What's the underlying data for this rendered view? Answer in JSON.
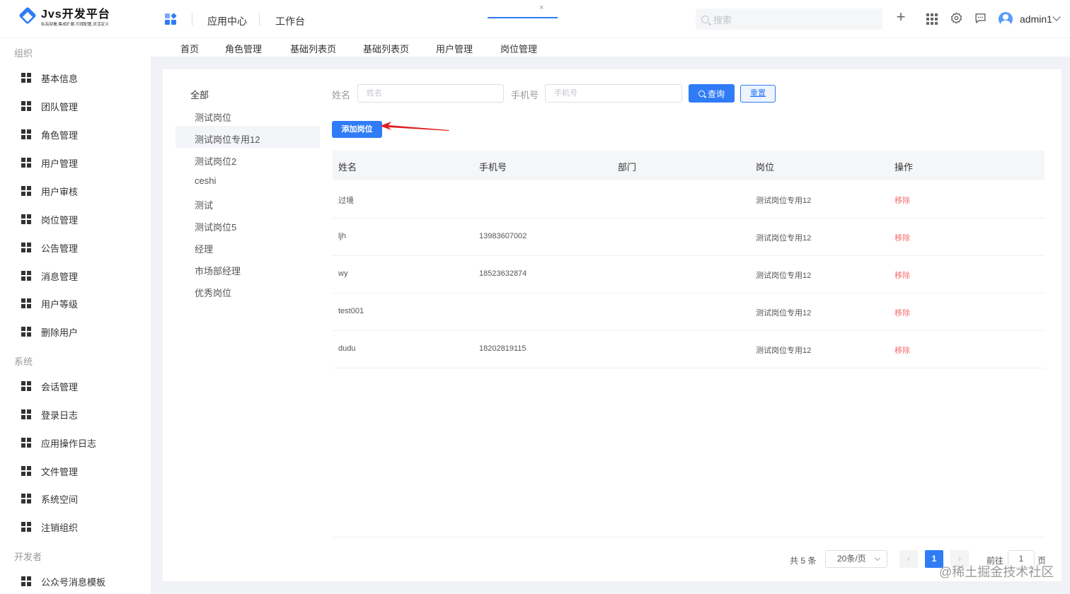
{
  "header": {
    "logo_title": "Jvs开发平台",
    "logo_subtitle": "私有部署,集成扩展,可视配置,灵活定义",
    "nav": [
      "应用中心",
      "工作台"
    ],
    "search_placeholder": "搜索",
    "user": "admin1",
    "icons": [
      "plus-icon",
      "apps-grid-icon",
      "settings-icon",
      "message-icon"
    ]
  },
  "sidebar": {
    "groups": [
      {
        "label": "组织",
        "items": [
          "基本信息",
          "团队管理",
          "角色管理",
          "用户管理",
          "用户审核",
          "岗位管理",
          "公告管理",
          "消息管理",
          "用户等级",
          "删除用户"
        ]
      },
      {
        "label": "系统",
        "items": [
          "会话管理",
          "登录日志",
          "应用操作日志",
          "文件管理",
          "系统空间",
          "注销组织"
        ]
      },
      {
        "label": "开发者",
        "items": [
          "公众号消息模板"
        ]
      }
    ]
  },
  "tabs": {
    "items": [
      "首页",
      "角色管理",
      "基础列表页",
      "基础列表页",
      "用户管理",
      "岗位管理"
    ],
    "active": "岗位管理",
    "close": "×"
  },
  "categories": {
    "all": "全部",
    "items": [
      "测试岗位",
      "测试岗位专用12",
      "测试岗位2",
      "ceshi",
      "测试",
      "测试岗位5",
      "经理",
      "市场部经理",
      "优秀岗位"
    ],
    "selected": "测试岗位专用12"
  },
  "filters": {
    "name_label": "姓名",
    "name_placeholder": "姓名",
    "phone_label": "手机号",
    "phone_placeholder": "手机号",
    "query_button": "查询",
    "reset_button": "重置"
  },
  "add_button": "添加岗位",
  "table": {
    "columns": [
      "姓名",
      "手机号",
      "部门",
      "岗位",
      "操作"
    ],
    "rows": [
      {
        "name": "过境",
        "phone": "",
        "dept": "",
        "post": "测试岗位专用12",
        "action": "移除"
      },
      {
        "name": "ljh",
        "phone": "13983607002",
        "dept": "",
        "post": "测试岗位专用12",
        "action": "移除"
      },
      {
        "name": "wy",
        "phone": "18523632874",
        "dept": "",
        "post": "测试岗位专用12",
        "action": "移除"
      },
      {
        "name": "test001",
        "phone": "",
        "dept": "",
        "post": "测试岗位专用12",
        "action": "移除"
      },
      {
        "name": "dudu",
        "phone": "18202819115",
        "dept": "",
        "post": "测试岗位专用12",
        "action": "移除"
      }
    ]
  },
  "pagination": {
    "total": "共 5 条",
    "page_size": "20条/页",
    "prev": "‹",
    "current": "1",
    "next": "›",
    "goto": "前往",
    "goto_value": "1",
    "page_unit": "页"
  },
  "watermark": "@稀土掘金技术社区",
  "colors": {
    "primary": "#2f7cf6",
    "danger": "#f56c6c",
    "annotation_arrow": "#e02020"
  }
}
